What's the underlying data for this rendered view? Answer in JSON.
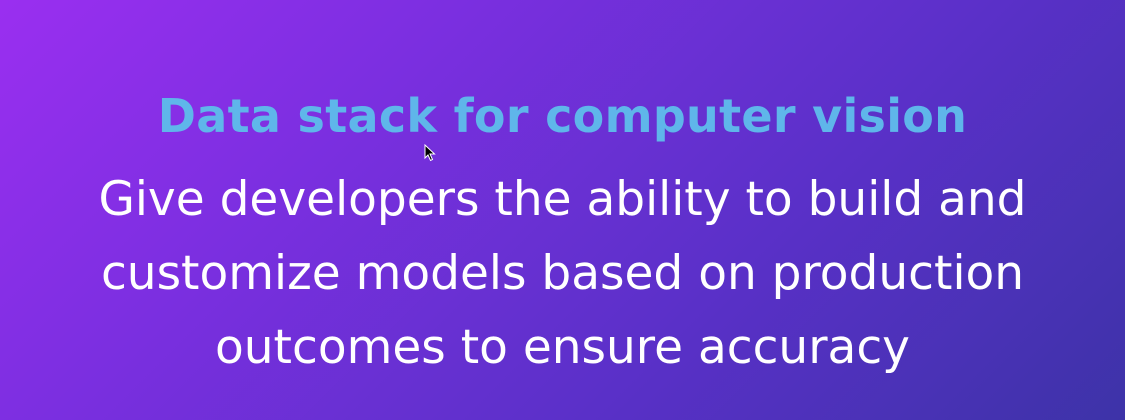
{
  "slide": {
    "headline": "Data stack for computer vision",
    "subline_lines": [
      "Give developers the ability to build and",
      "customize models based on production",
      "outcomes to ensure accuracy"
    ]
  },
  "colors": {
    "background_start": "#9a2ff0",
    "background_end": "#3d33a8",
    "headline": "#5fb6ea",
    "body_text": "#ffffff"
  },
  "icons": {
    "cursor": "mouse-pointer-icon"
  }
}
